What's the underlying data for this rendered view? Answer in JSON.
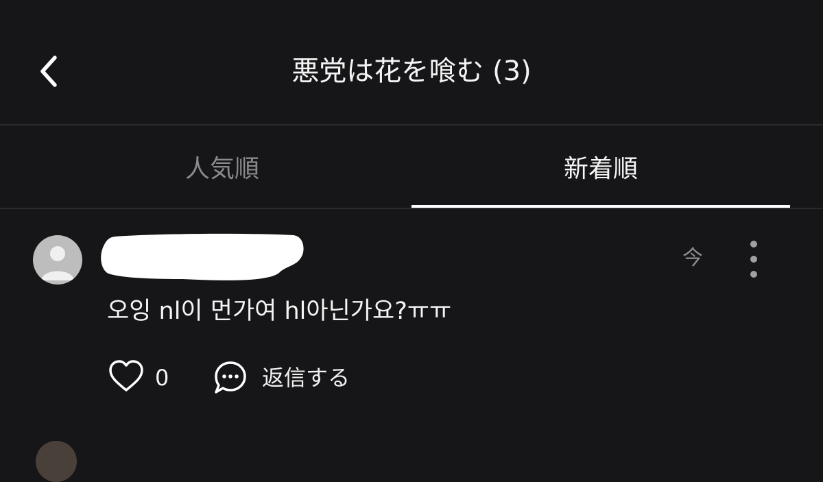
{
  "header": {
    "title": "悪党は花を喰む (3)",
    "back_icon": "chevron-left-icon"
  },
  "tabs": [
    {
      "label": "人気順",
      "selected": false
    },
    {
      "label": "新着順",
      "selected": true
    }
  ],
  "comments": [
    {
      "username_redacted": true,
      "timestamp": "今",
      "text": "오잉 nl이 먼가여 hl아닌가요?ㅠㅠ",
      "likes": "0",
      "reply_label": "返信する",
      "icons": {
        "avatar": "default-avatar-icon",
        "more": "more-vertical-icon",
        "like": "heart-icon",
        "reply": "chat-bubble-icon"
      }
    }
  ],
  "colors": {
    "background": "#161618",
    "text_primary": "#f4f4f4",
    "text_secondary": "#8a8a8e",
    "divider": "#2b2b2e",
    "tab_indicator": "#ffffff"
  }
}
